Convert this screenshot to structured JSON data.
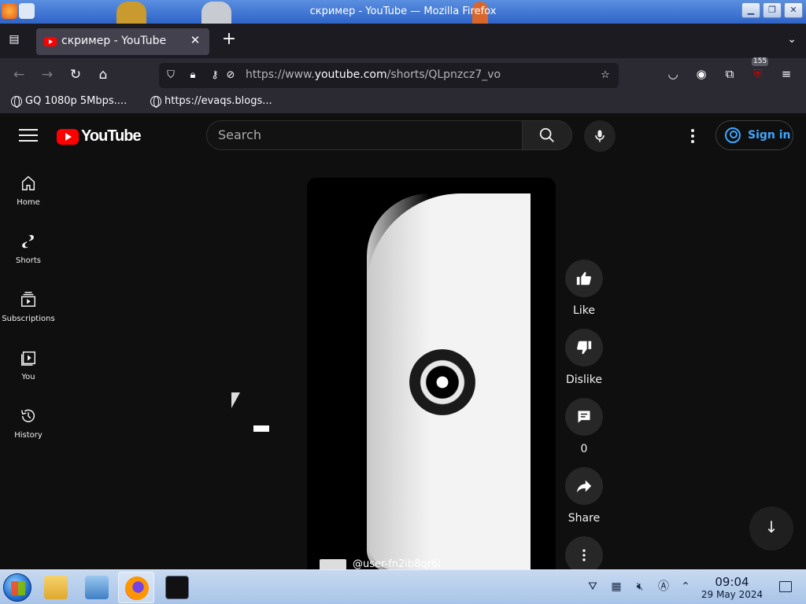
{
  "window": {
    "title": "скример - YouTube — Mozilla Firefox",
    "controls": [
      "minimize",
      "maximize",
      "close"
    ]
  },
  "tabs": [
    {
      "title": "скример - YouTube",
      "active": true,
      "favicon": "youtube-favicon"
    }
  ],
  "navigation": {
    "url_prefix": "https://www.",
    "url_domain": "youtube.com",
    "url_path": "/shorts/QLpnzcz7_vo",
    "extension_badge": "155"
  },
  "bookmarks": [
    {
      "label": "GQ 1080p 5Mbps...."
    },
    {
      "label": "https://evaqs.blogs..."
    }
  ],
  "youtube": {
    "logo_text": "YouTube",
    "search_placeholder": "Search",
    "sign_in_label": "Sign in",
    "guide": [
      {
        "label": "Home",
        "icon": "home-icon"
      },
      {
        "label": "Shorts",
        "icon": "shorts-icon"
      },
      {
        "label": "Subscriptions",
        "icon": "subscriptions-icon"
      },
      {
        "label": "You",
        "icon": "you-icon"
      },
      {
        "label": "History",
        "icon": "history-icon"
      }
    ],
    "short": {
      "channel": "@user-fn2ib8qr6i"
    },
    "actions": {
      "like": "Like",
      "dislike": "Dislike",
      "comments_count": "0",
      "share": "Share"
    }
  },
  "taskbar": {
    "time": "09:04",
    "date": "29 May 2024"
  },
  "colors": {
    "youtube_red": "#ff0000",
    "link_blue": "#3ea6ff",
    "page_bg": "#0f0f0f"
  }
}
